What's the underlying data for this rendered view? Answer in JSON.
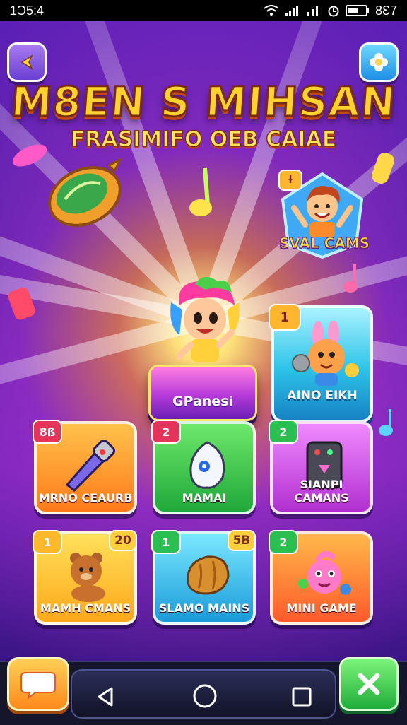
{
  "status_bar": {
    "time": "1Ͻ5:4",
    "battery_text": "8Ɛ7"
  },
  "header": {
    "title": "M8EN S MIHSAN",
    "subtitle": "FRASIMIFO OEB CAIAE"
  },
  "featured": {
    "hero_badge": "ƚ",
    "hero_label": "SVAL CAMS",
    "play_button_label": "GPanesi",
    "feature_badge": "1",
    "feature_label": "AINO EIKH"
  },
  "tiles": [
    {
      "label": "MRNO CEAURB",
      "badge": "8ß",
      "badge_color": "#e5335a",
      "bg": "#ff8a24",
      "icon": "rocket-icon"
    },
    {
      "label": "MAMAI",
      "badge": "2",
      "badge_color": "#e5335a",
      "bg": "#2fc24a",
      "icon": "egg-icon"
    },
    {
      "label": "SIANPI CAMANS",
      "badge": "2",
      "badge_color": "#2bbf52",
      "bg": "#d545e6",
      "icon": "console-icon"
    },
    {
      "label": "MAMH CMANS",
      "badge": "1",
      "badge_color": "#ffb82a",
      "bg": "#ffb82a",
      "icon": "bear-icon",
      "count": "20"
    },
    {
      "label": "SLAMO MAINS",
      "badge": "1",
      "badge_color": "#2bbf52",
      "bg": "#25b6e6",
      "icon": "bread-icon",
      "count": "5B"
    },
    {
      "label": "MINI GAME",
      "badge": "2",
      "badge_color": "#2bbf52",
      "bg": "#ff7a2a",
      "icon": "creature-icon"
    }
  ],
  "colors": {
    "title_yellow": "#ffd22e",
    "accent_purple": "#6a1fb6",
    "nav_bg": "#15152b"
  }
}
